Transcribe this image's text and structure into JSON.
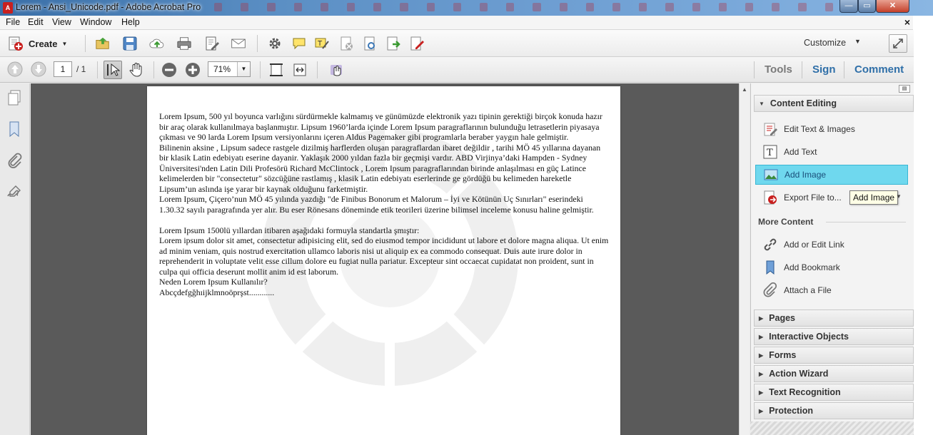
{
  "window": {
    "title": "Lorem - Ansi_Unicode.pdf - Adobe Acrobat Pro",
    "app_icon": "acrobat-icon",
    "controls": {
      "minimize": "—",
      "maximize": "▭",
      "close": "✕"
    }
  },
  "menu": {
    "items": [
      "File",
      "Edit",
      "View",
      "Window",
      "Help"
    ],
    "doc_close": "×"
  },
  "toolbar": {
    "create_label": "Create",
    "customize_label": "Customize",
    "page_current": "1",
    "page_total": "/ 1",
    "zoom": "71%"
  },
  "tabs": {
    "tools": "Tools",
    "sign": "Sign",
    "comment": "Comment"
  },
  "document": {
    "paragraphs": [
      "Lorem Ipsum, 500 yıl boyunca varlığını sürdürmekle kalmamış ve günümüzde elektronik yazı tipinin gerektiği birçok konuda hazır bir araç olarak kullanılmaya başlanmıştır. Lipsum 1960’larda içinde Lorem Ipsum paragraflarının bulunduğu letrasetlerin piyasaya çıkması ve 90 larda Lorem Ipsum versiyonlarını içeren Aldus Pagemaker gibi programlarla beraber yaygın hale gelmiştir.",
      "Bilinenin aksine , Lipsum sadece rastgele dizilmiş harflerden oluşan paragraflardan ibaret değildir , tarihi MÖ 45 yıllarına dayanan bir klasik Latin edebiyatı eserine dayanir. Yaklaşık 2000 yıldan fazla bir geçmişi vardır. ABD Virjinya’daki Hampden - Sydney Üniversitesi'nden Latin Dili Profesörü Richard McClintock , Lorem Ipsum paragraflarından birinde anlaşılması en güç Latince kelimelerden bir \"consectetur\" sözcüğüne rastlamış , klasik Latin edebiyatı eserlerinde ge gördüğü bu kelimeden hareketle Lipsum’un aslında işe yarar bir kaynak olduğunu farketmiştir.",
      "Lorem Ipsum, Çiçero’nun MÖ 45 yılında yazdığı \"de Finibus Bonorum et Malorum – İyi ve Kötünün Uç Sınırları\" eserindeki 1.30.32 sayılı paragrafında yer alır. Bu eser Rönesans döneminde etik teorileri üzerine bilimsel inceleme konusu haline gelmiştir.",
      "",
      "Lorem Ipsum 1500lü yıllardan itibaren aşağıdaki formuyla standartla şmıştır:",
      "Lorem ipsum dolor sit amet, consectetur adipisicing elit, sed do eiusmod tempor incididunt ut labore et dolore magna aliqua. Ut enim ad minim veniam, quis nostrud exercitation ullamco laboris nisi ut aliquip ex ea commodo consequat. Duis aute irure dolor in reprehenderit in voluptate velit esse cillum dolore eu fugiat nulla pariatur. Excepteur sint occaecat cupidatat non proident, sunt in culpa qui officia deserunt mollit anim id est laborum.",
      "Neden Lorem Ipsum Kullanılır?",
      "Abcçdefgğhıijklmnoöprşst............"
    ]
  },
  "right_pane": {
    "content_editing": {
      "header": "Content Editing",
      "items": [
        {
          "label": "Edit Text & Images",
          "icon": "edit-text-images-icon"
        },
        {
          "label": "Add Text",
          "icon": "add-text-icon"
        },
        {
          "label": "Add Image",
          "icon": "add-image-icon",
          "selected": true
        },
        {
          "label": "Export File to...",
          "icon": "export-file-icon"
        }
      ],
      "more_content_label": "More Content",
      "more_items": [
        {
          "label": "Add or Edit Link",
          "icon": "link-icon"
        },
        {
          "label": "Add Bookmark",
          "icon": "bookmark-icon"
        },
        {
          "label": "Attach a File",
          "icon": "paperclip-icon"
        }
      ]
    },
    "collapsed_panels": [
      "Pages",
      "Interactive Objects",
      "Forms",
      "Action Wizard",
      "Text Recognition",
      "Protection"
    ],
    "tooltip": "Add Image"
  },
  "colors": {
    "selected_item": "#6fd8ee",
    "link_tab": "#2f6fa8",
    "doc_background": "#5a5a5a"
  }
}
